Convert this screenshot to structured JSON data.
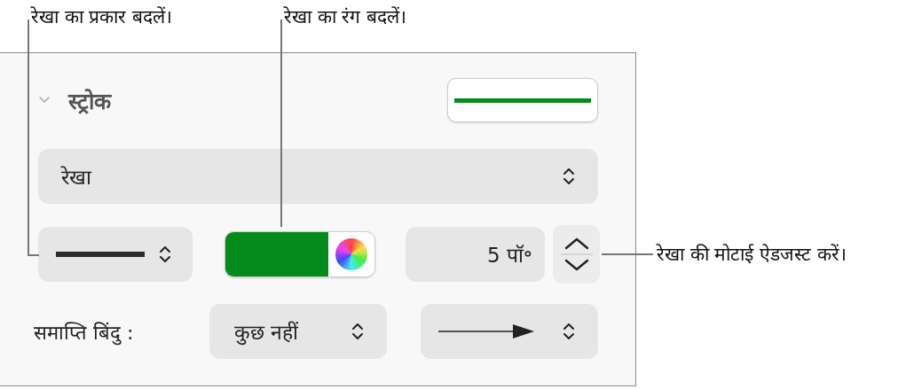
{
  "callouts": [
    {
      "text": "रेखा का प्रकार बदलें।"
    },
    {
      "text": "रेखा का रंग बदलें।"
    },
    {
      "text": "रेखा की मोटाई ऐडजस्ट करें।"
    }
  ],
  "stroke_section": {
    "title": "स्ट्रोक",
    "expanded": true,
    "line_type": "रेखा",
    "color": "#058a1c",
    "width": "5 पॉ॰",
    "endpoints_label": "समाप्ति बिंदु :",
    "start_endpoint": "कुछ नहीं"
  }
}
